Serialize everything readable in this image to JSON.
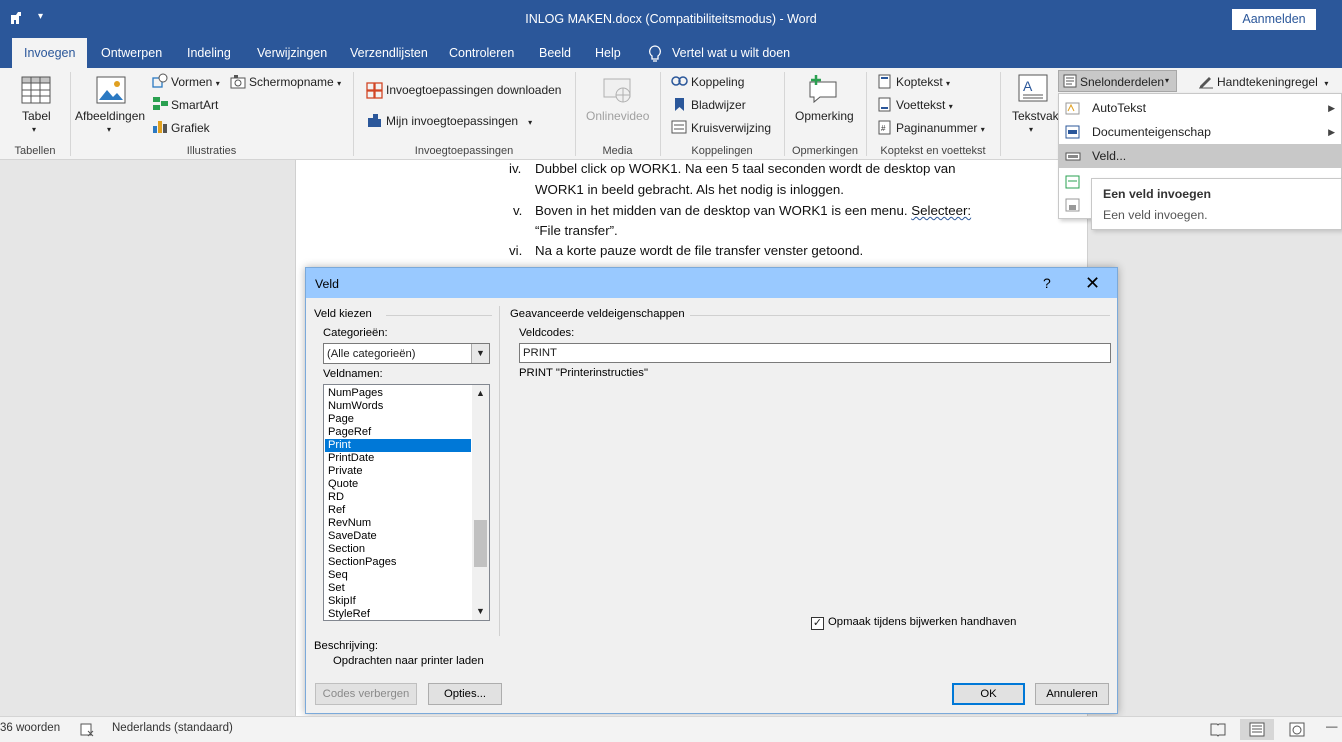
{
  "titlebar": {
    "title": "INLOG MAKEN.docx (Compatibiliteitsmodus)  -  Word",
    "signin_label": "Aanmelden"
  },
  "tabs": [
    {
      "label": "Invoegen",
      "active": true
    },
    {
      "label": "Ontwerpen"
    },
    {
      "label": "Indeling"
    },
    {
      "label": "Verwijzingen"
    },
    {
      "label": "Verzendlijsten"
    },
    {
      "label": "Controleren"
    },
    {
      "label": "Beeld"
    },
    {
      "label": "Help"
    }
  ],
  "tell_me": "Vertel wat u wilt doen",
  "ribbon": {
    "tabel": "Tabel",
    "afbeeldingen": "Afbeeldingen",
    "vormen": "Vormen",
    "smartart": "SmartArt",
    "grafiek": "Grafiek",
    "schermopname": "Schermopname",
    "invoeg_download": "Invoegtoepassingen downloaden",
    "mijn_invoeg": "Mijn invoegtoepassingen",
    "onlinevideo": "Onlinevideo",
    "koppeling": "Koppeling",
    "bladwijzer": "Bladwijzer",
    "kruisverwijzing": "Kruisverwijzing",
    "opmerking": "Opmerking",
    "koptekst": "Koptekst",
    "voettekst": "Voettekst",
    "paginanummer": "Paginanummer",
    "tekstvak": "Tekstvak",
    "snelonderdelen": "Snelonderdelen",
    "handtekeningregel": "Handtekeningregel",
    "groups": {
      "tabellen": "Tabellen",
      "illustraties": "Illustraties",
      "invoegtoepassingen": "Invoegtoepassingen",
      "media": "Media",
      "koppelingen": "Koppelingen",
      "opmerkingen": "Opmerkingen",
      "koptekst_voettekst": "Koptekst en voettekst"
    }
  },
  "dropdown": {
    "items": [
      "AutoTekst",
      "Documenteigenschap",
      "Veld..."
    ],
    "tooltip_title": "Een veld invoegen",
    "tooltip_desc": "Een veld invoegen."
  },
  "document": {
    "lines": [
      {
        "num": "iv.",
        "text": "Dubbel click op WORK1. Na een 5 taal seconden wordt de desktop van"
      },
      {
        "num": "",
        "text": "WORK1 in beeld gebracht. Als het nodig is inloggen."
      },
      {
        "num": "v.",
        "text": "Boven in het midden van de desktop van WORK1 is een menu. ",
        "squiggle": "Selecteer:"
      },
      {
        "num": "",
        "text": "“File transfer”."
      },
      {
        "num": "vi.",
        "text": "Na a korte pauze wordt de file transfer venster getoond."
      }
    ]
  },
  "dialog": {
    "title": "Veld",
    "help": "?",
    "close": "✕",
    "left_group": "Veld kiezen",
    "categories_label": "Categorieën:",
    "category_value": "(Alle categorieën)",
    "fieldnames_label": "Veldnamen:",
    "fieldnames": [
      "NumPages",
      "NumWords",
      "Page",
      "PageRef",
      "Print",
      "PrintDate",
      "Private",
      "Quote",
      "RD",
      "Ref",
      "RevNum",
      "SaveDate",
      "Section",
      "SectionPages",
      "Seq",
      "Set",
      "SkipIf",
      "StyleRef"
    ],
    "selected_field": "Print",
    "right_group": "Geavanceerde veldeigenschappen",
    "fieldcodes_label": "Veldcodes:",
    "fieldcode_value": "PRINT",
    "syntax": "PRINT \"Printerinstructies\"",
    "keep_format": "Opmaak tijdens bijwerken handhaven",
    "keep_format_checked": true,
    "description_label": "Beschrijving:",
    "description": "Opdrachten naar printer laden",
    "btn_hide_codes": "Codes verbergen",
    "btn_options": "Opties...",
    "btn_ok": "OK",
    "btn_cancel": "Annuleren"
  },
  "statusbar": {
    "words": "36 woorden",
    "language": "Nederlands (standaard)"
  },
  "colors": {
    "word_blue": "#2b579a",
    "dialog_title": "#99c9ff",
    "selection": "#0078d7"
  }
}
